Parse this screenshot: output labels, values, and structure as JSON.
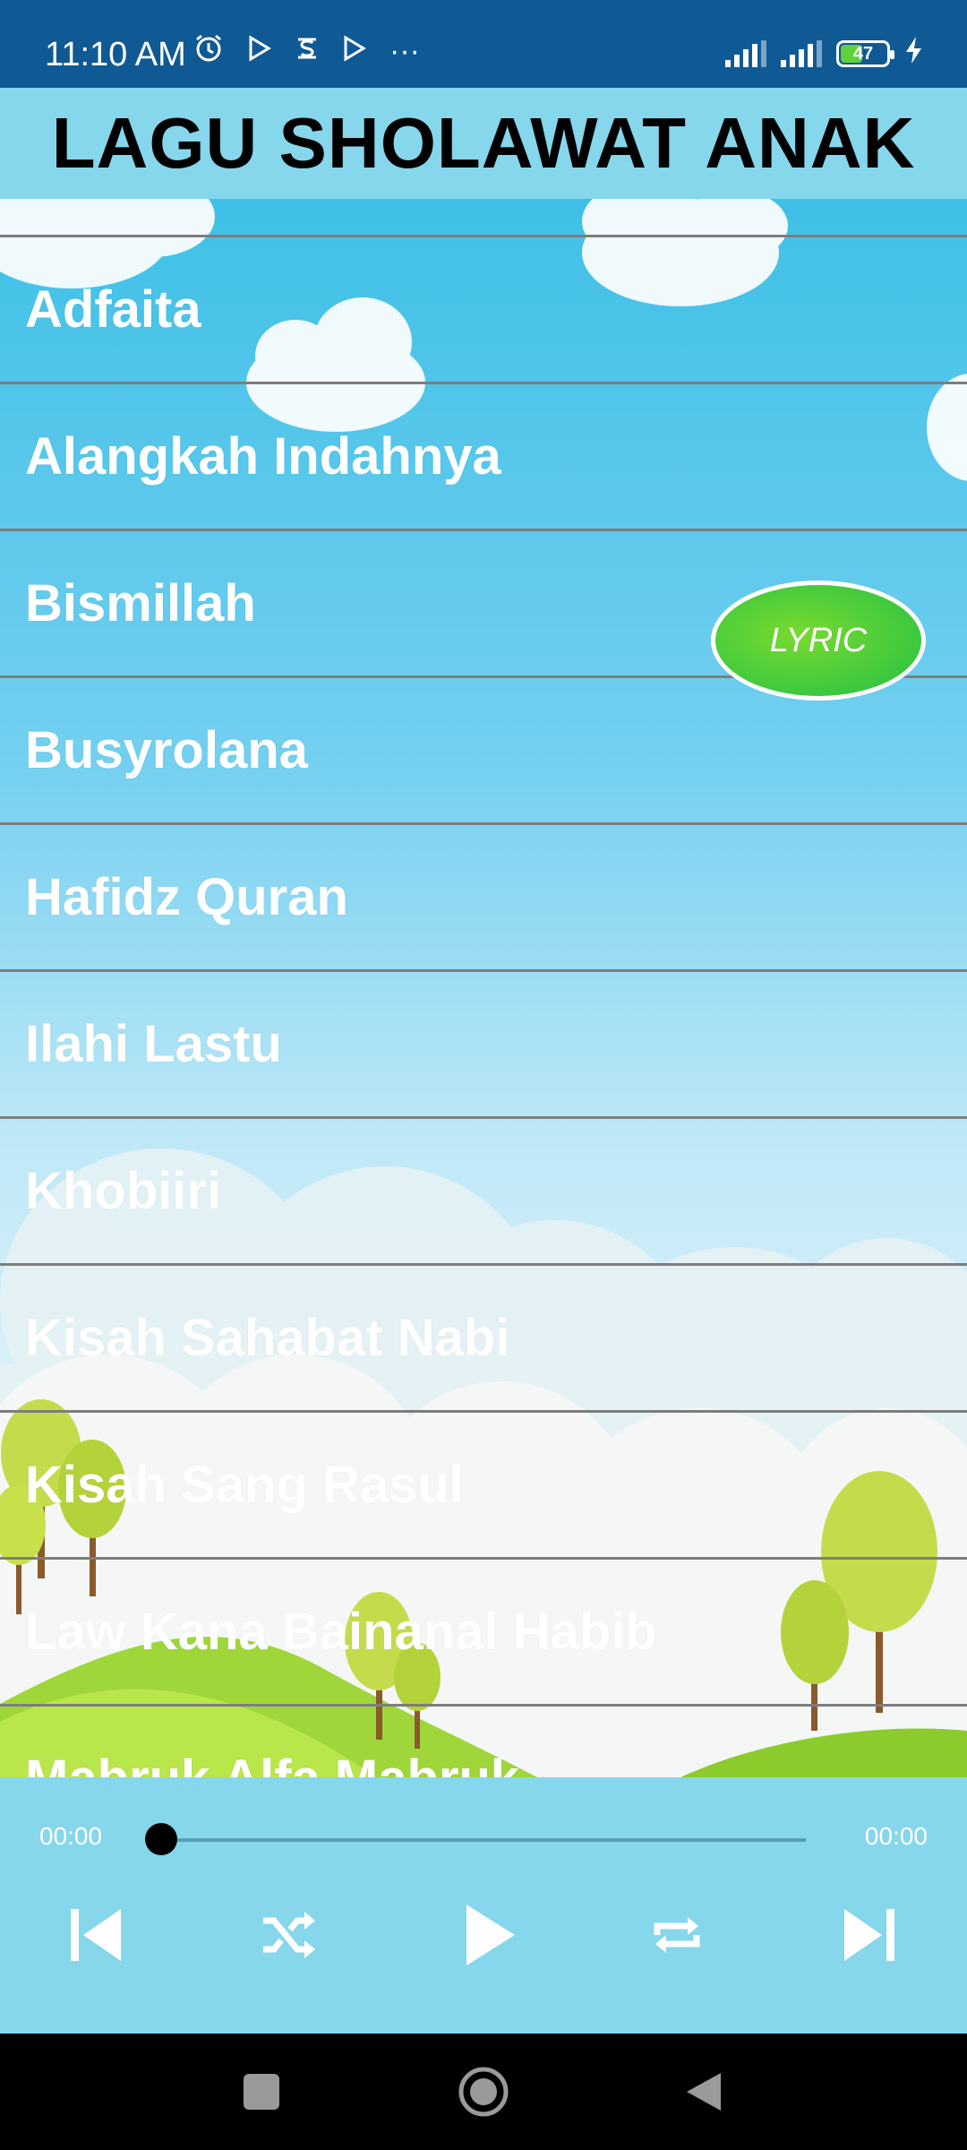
{
  "status_bar": {
    "time": "11:10 AM",
    "left_icons": [
      "alarm-icon",
      "play-store-icon",
      "notification-icon",
      "play-store-icon",
      "more-icon"
    ],
    "battery_level": "47",
    "more_glyph": "···"
  },
  "app": {
    "title": "LAGU SHOLAWAT ANAK"
  },
  "songs": [
    "Adfaita",
    "Alangkah Indahnya",
    "Bismillah",
    "Busyrolana",
    "Hafidz Quran",
    "Ilahi Lastu",
    "Khobiiri",
    "Kisah Sahabat Nabi",
    "Kisah Sang Rasul",
    "Law Kana Bainanal Habib",
    "Mabruk Alfa Mabruk"
  ],
  "lyric_button": {
    "label": "LYRIC",
    "color": "#3fcf3a"
  },
  "player": {
    "current_time": "00:00",
    "total_time": "00:00",
    "progress": 0,
    "controls": [
      "skip-previous-icon",
      "shuffle-icon",
      "play-icon",
      "repeat-icon",
      "skip-next-icon"
    ]
  },
  "colors": {
    "status_bar": "#0f5a95",
    "title_bar": "#86d6ec",
    "player_bg": "#86d6ec",
    "divider": "#7d7d7d"
  }
}
